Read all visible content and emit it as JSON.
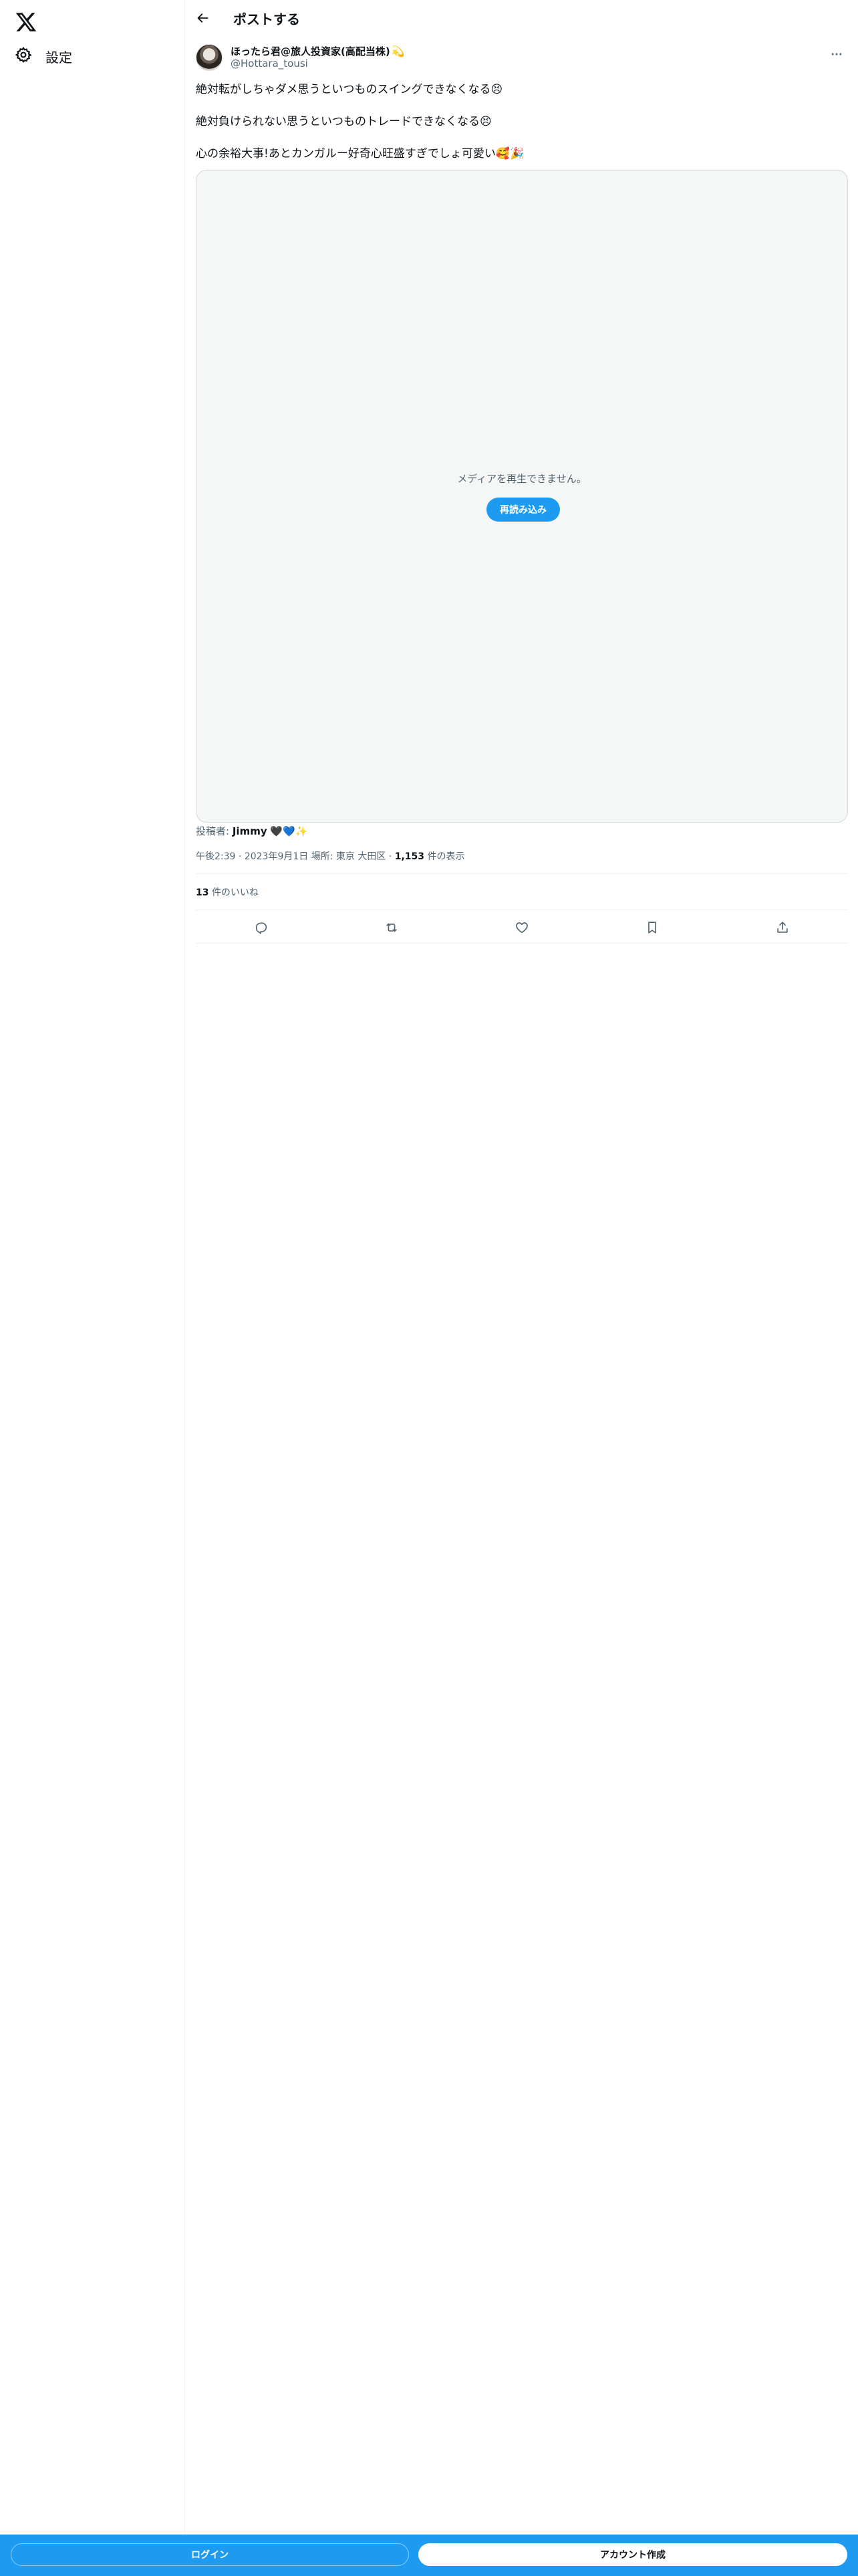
{
  "sidebar": {
    "logo_icon": "x-logo-icon",
    "settings_label": "設定",
    "settings_icon": "gear-icon"
  },
  "header": {
    "back_icon": "arrow-left-icon",
    "title": "ポストする"
  },
  "post": {
    "author_name": "ほったら君@旅人投資家(高配当株)",
    "author_emoji": "💫",
    "author_handle": "@Hottara_tousi",
    "more_icon": "more-dots-icon",
    "lines": [
      "絶対転がしちゃダメ思うといつものスイングできなくなる😣",
      "絶対負けられない思うといつものトレードできなくなる😣",
      "心の余裕大事!あとカンガルー好奇心旺盛すぎでしょ可愛い🥰🎉"
    ],
    "media": {
      "message": "メディアを再生できません。",
      "reload_label": "再読み込み"
    },
    "posted_by_label": "投稿者:",
    "posted_by_name": "Jimmy",
    "posted_by_emoji": "🖤💙✨",
    "time": "午後2:39",
    "date": "2023年9月1日",
    "location_label": "場所:",
    "location": "東京 大田区",
    "views_count": "1,153",
    "views_label": "件の表示",
    "likes_count": "13",
    "likes_label": "件のいいね"
  },
  "actions": [
    {
      "icon": "reply-icon"
    },
    {
      "icon": "repost-icon"
    },
    {
      "icon": "like-icon"
    },
    {
      "icon": "bookmark-icon"
    },
    {
      "icon": "share-icon"
    }
  ],
  "bottom_bar": {
    "login_label": "ログイン",
    "signup_label": "アカウント作成"
  },
  "colors": {
    "accent": "#1d9bf0",
    "text_primary": "#0f1419",
    "text_secondary": "#536471"
  }
}
